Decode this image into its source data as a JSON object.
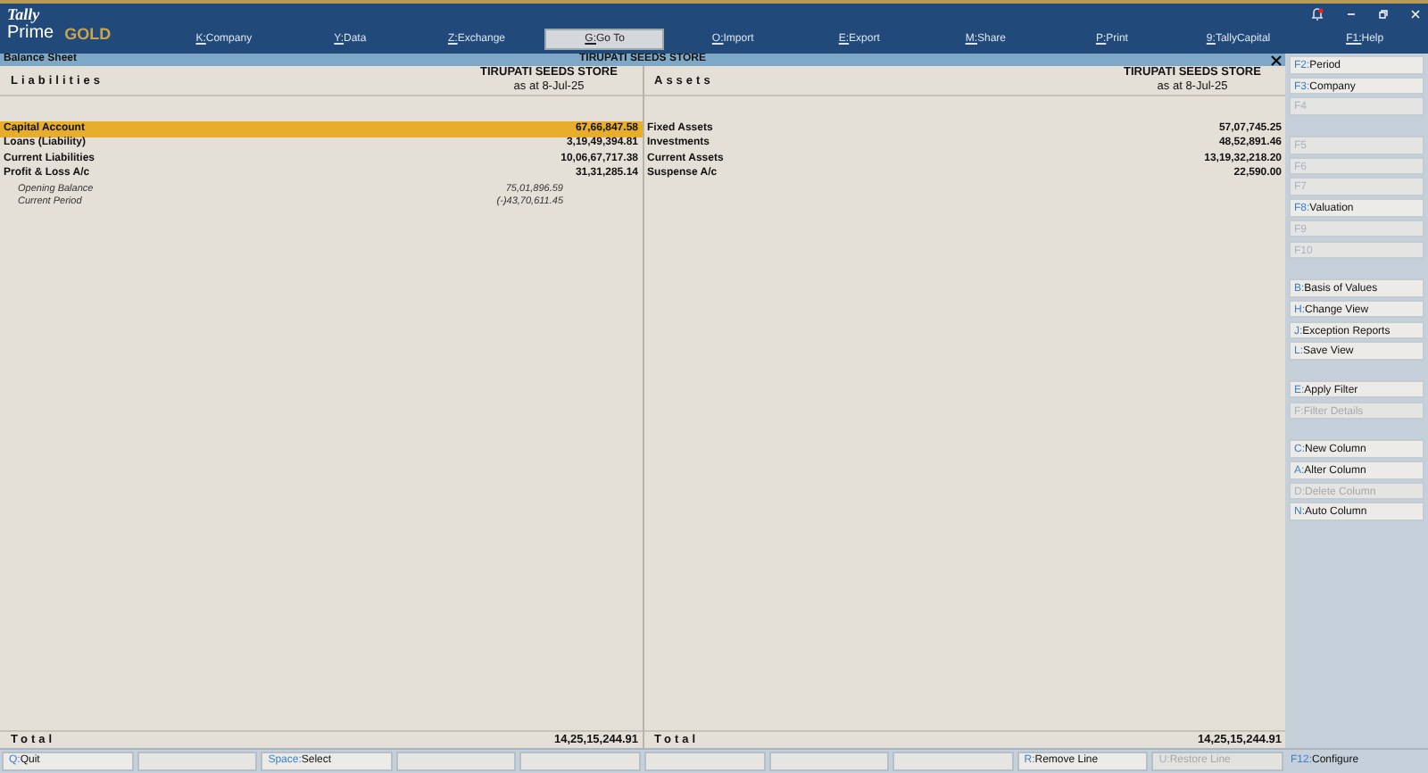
{
  "logo": {
    "brand": "Tally",
    "product": "Prime",
    "edition": "GOLD"
  },
  "menu": [
    {
      "key": "K:",
      "label": "Company",
      "selected": false
    },
    {
      "key": "Y:",
      "label": "Data",
      "selected": false
    },
    {
      "key": "Z:",
      "label": "Exchange",
      "selected": false
    },
    {
      "key": "G:",
      "label": "Go To",
      "selected": true
    },
    {
      "key": "O:",
      "label": "Import",
      "selected": false
    },
    {
      "key": "E:",
      "label": "Export",
      "selected": false
    },
    {
      "key": "M:",
      "label": "Share",
      "selected": false
    },
    {
      "key": "P:",
      "label": "Print",
      "selected": false
    },
    {
      "key": "9:",
      "label": "TallyCapital",
      "selected": false
    },
    {
      "key": "F1:",
      "label": "Help",
      "selected": false
    }
  ],
  "title_bar": {
    "report": "Balance Sheet",
    "company": "TIRUPATI SEEDS STORE"
  },
  "panels": [
    {
      "heading": "Liabilities",
      "company": "TIRUPATI SEEDS STORE",
      "date": "as at 8-Jul-25",
      "rows": [
        {
          "label": "Capital Account",
          "amount": "67,66,847.58",
          "selected": true
        },
        {
          "label": "Loans (Liability)",
          "amount": "3,19,49,394.81",
          "selected": false
        },
        {
          "label": "Current Liabilities",
          "amount": "10,06,67,717.38",
          "selected": false
        },
        {
          "label": "Profit & Loss A/c",
          "amount": "31,31,285.14",
          "selected": false,
          "children": [
            {
              "label": "Opening Balance",
              "amount": "75,01,896.59"
            },
            {
              "label": "Current Period",
              "amount": "(-)43,70,611.45"
            }
          ]
        }
      ],
      "total_label": "Total",
      "total": "14,25,15,244.91"
    },
    {
      "heading": "Assets",
      "company": "TIRUPATI SEEDS STORE",
      "date": "as at 8-Jul-25",
      "rows": [
        {
          "label": "Fixed Assets",
          "amount": "57,07,745.25",
          "selected": false
        },
        {
          "label": "Investments",
          "amount": "48,52,891.46",
          "selected": false
        },
        {
          "label": "Current Assets",
          "amount": "13,19,32,218.20",
          "selected": false
        },
        {
          "label": "Suspense A/c",
          "amount": "22,590.00",
          "selected": false
        }
      ],
      "total_label": "Total",
      "total": "14,25,15,244.91"
    }
  ],
  "sidebar": [
    {
      "kind": "button",
      "key": "F2:",
      "label": "Period",
      "disabled": false
    },
    {
      "kind": "button",
      "key": "F3:",
      "label": "Company",
      "disabled": false
    },
    {
      "kind": "button",
      "key": "F4",
      "disabled": true
    },
    {
      "kind": "gap"
    },
    {
      "kind": "button",
      "key": "F5",
      "disabled": true
    },
    {
      "kind": "button",
      "key": "F6",
      "disabled": true
    },
    {
      "kind": "button",
      "key": "F7",
      "disabled": true
    },
    {
      "kind": "button",
      "key": "F8:",
      "label": "Valuation",
      "disabled": false
    },
    {
      "kind": "button",
      "key": "F9",
      "disabled": true
    },
    {
      "kind": "button",
      "key": "F10",
      "disabled": true
    },
    {
      "kind": "gap"
    },
    {
      "kind": "button",
      "key": "B:",
      "label": "Basis of Values",
      "disabled": false
    },
    {
      "kind": "button",
      "key": "H:",
      "label": "Change View",
      "disabled": false
    },
    {
      "kind": "button",
      "key": "J:",
      "label": "Exception Reports",
      "disabled": false
    },
    {
      "kind": "button",
      "key": "L:",
      "label": "Save View",
      "disabled": false
    },
    {
      "kind": "gap"
    },
    {
      "kind": "button",
      "key": "E:",
      "label": "Apply Filter",
      "disabled": false
    },
    {
      "kind": "button",
      "key": "F:",
      "label": "Filter Details",
      "disabled": true
    },
    {
      "kind": "gap"
    },
    {
      "kind": "button",
      "key": "C:",
      "label": "New Column",
      "disabled": false
    },
    {
      "kind": "button",
      "key": "A:",
      "label": "Alter Column",
      "disabled": false
    },
    {
      "kind": "button",
      "key": "D:",
      "label": "Delete Column",
      "disabled": true
    },
    {
      "kind": "button",
      "key": "N:",
      "label": "Auto Column",
      "disabled": false
    }
  ],
  "bottom_bar": [
    {
      "kind": "button",
      "key": "Q:",
      "label": "Quit",
      "disabled": false
    },
    {
      "kind": "blank"
    },
    {
      "kind": "button",
      "key": "Space:",
      "label": "Select",
      "disabled": false
    },
    {
      "kind": "blank"
    },
    {
      "kind": "blank"
    },
    {
      "kind": "blank"
    },
    {
      "kind": "blank"
    },
    {
      "kind": "blank"
    },
    {
      "kind": "button",
      "key": "R:",
      "label": "Remove Line",
      "disabled": false
    },
    {
      "kind": "button",
      "key": "U:",
      "label": "Restore Line",
      "disabled": true
    }
  ],
  "configure": {
    "key": "F12:",
    "label": "Configure"
  }
}
